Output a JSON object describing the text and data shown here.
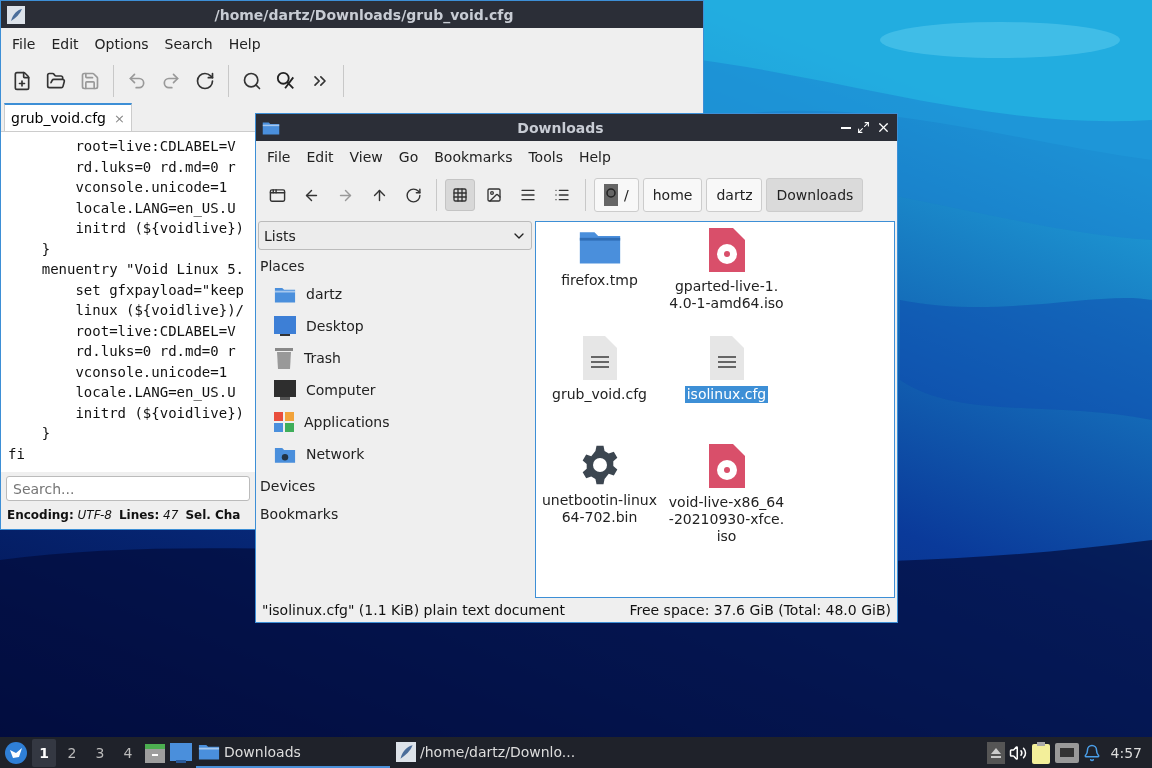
{
  "editor": {
    "title": "/home/dartz/Downloads/grub_void.cfg",
    "menu": [
      "File",
      "Edit",
      "Options",
      "Search",
      "Help"
    ],
    "tab": {
      "label": "grub_void.cfg",
      "close": "×"
    },
    "lines": [
      "        root=live:CDLABEL=V",
      "        rd.luks=0 rd.md=0 r",
      "        vconsole.unicode=1",
      "        locale.LANG=en_US.U",
      "        initrd (${voidlive})",
      "    }",
      "    menuentry \"Void Linux 5.",
      "        set gfxpayload=\"keep",
      "        linux (${voidlive})/",
      "        root=live:CDLABEL=V",
      "        rd.luks=0 rd.md=0 r",
      "        vconsole.unicode=1",
      "        locale.LANG=en_US.U",
      "        initrd (${voidlive})",
      "    }",
      "fi"
    ],
    "search": {
      "placeholder": "Search..."
    },
    "status": [
      "**Encoding:** *UTF-8*",
      "**Lines:** *47*",
      "**Sel. Cha**"
    ]
  },
  "file_manager": {
    "title": "Downloads",
    "menu": [
      "File",
      "Edit",
      "View",
      "Go",
      "Bookmarks",
      "Tools",
      "Help"
    ],
    "views": [
      {
        "kind": "icons",
        "selected": true
      },
      {
        "kind": "thumbnails",
        "selected": false
      },
      {
        "kind": "compact",
        "selected": false
      },
      {
        "kind": "details",
        "selected": false
      }
    ],
    "path": [
      {
        "label": "/",
        "kind": "root",
        "selected": false
      },
      {
        "label": "home",
        "kind": "dir",
        "selected": false
      },
      {
        "label": "dartz",
        "kind": "dir",
        "selected": false
      },
      {
        "label": "Downloads",
        "kind": "dir",
        "selected": true
      }
    ],
    "side_mode": "Lists",
    "sections": [
      {
        "title": "Places",
        "items": [
          {
            "label": "dartz",
            "kind": "home"
          },
          {
            "label": "Desktop",
            "kind": "desktop"
          },
          {
            "label": "Trash",
            "kind": "trash"
          },
          {
            "label": "Computer",
            "kind": "computer"
          },
          {
            "label": "Applications",
            "kind": "apps"
          },
          {
            "label": "Network",
            "kind": "network"
          }
        ]
      },
      {
        "title": "Devices"
      },
      {
        "title": "Bookmarks"
      }
    ],
    "files": [
      {
        "name": "firefox.tmp",
        "kind": "folder",
        "selected": false
      },
      {
        "name": "gparted-live-1.4.0-1-amd64.iso",
        "kind": "disc",
        "selected": false
      },
      {
        "name": "grub_void.cfg",
        "kind": "text",
        "selected": false
      },
      {
        "name": "isolinux.cfg",
        "kind": "text",
        "selected": true
      },
      {
        "name": "unetbootin-linux64-702.bin",
        "kind": "exec",
        "selected": false
      },
      {
        "name": "void-live-x86_64-20210930-xfce.iso",
        "kind": "disc",
        "selected": false
      }
    ],
    "status_left": "\"isolinux.cfg\" (1.1 KiB) plain text document",
    "status_right": "Free space: 37.6 GiB (Total: 48.0 GiB)"
  },
  "taskbar": {
    "workspaces": [
      {
        "label": "1",
        "selected": true
      },
      {
        "label": "2",
        "selected": false
      },
      {
        "label": "3",
        "selected": false
      },
      {
        "label": "4",
        "selected": false
      }
    ],
    "tasks": [
      {
        "label": "Downloads",
        "kind": "folder",
        "selected": true
      },
      {
        "label": "/home/dartz/Downlo...",
        "kind": "editor",
        "selected": false
      }
    ],
    "clock": "4:57"
  }
}
